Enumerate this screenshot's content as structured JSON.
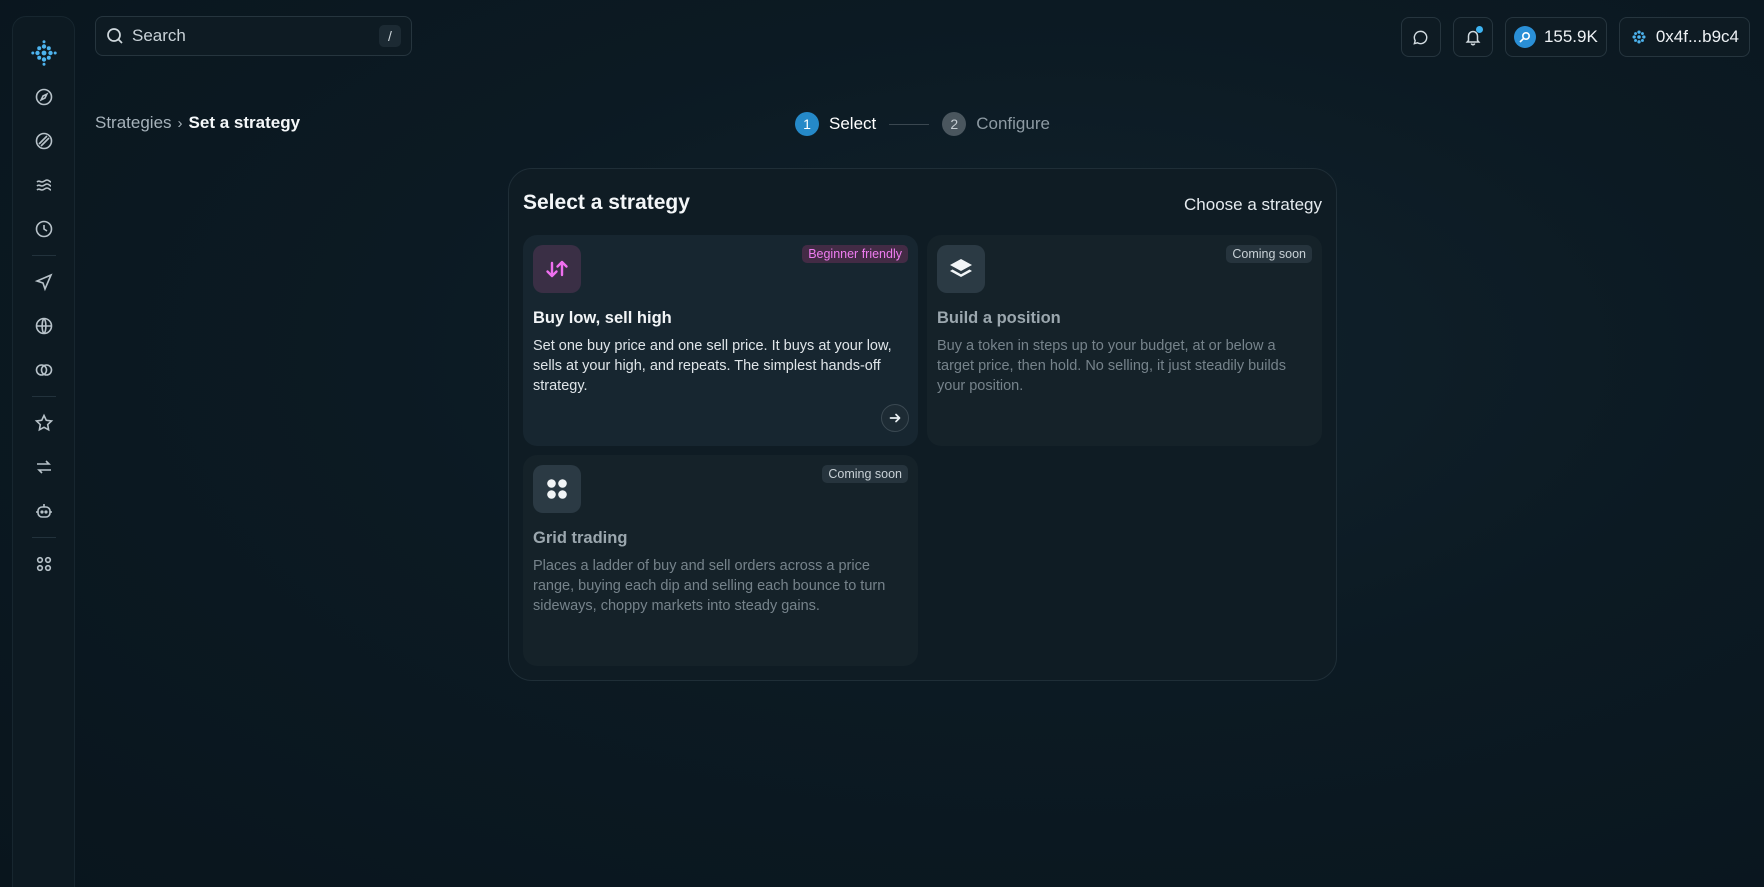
{
  "search": {
    "placeholder": "Search",
    "shortcut": "/"
  },
  "header": {
    "balance": "155.9K",
    "wallet": "0x4f...b9c4"
  },
  "breadcrumb": {
    "parent": "Strategies",
    "separator": "›",
    "current": "Set a strategy"
  },
  "stepper": {
    "steps": [
      {
        "num": "1",
        "label": "Select"
      },
      {
        "num": "2",
        "label": "Configure"
      }
    ]
  },
  "panel": {
    "title": "Select a strategy",
    "subtitle": "Choose a strategy",
    "cards": [
      {
        "title": "Buy low, sell high",
        "badge": "Beginner friendly",
        "desc": "Set one buy price and one sell price. It buys at your low, sells at your high, and repeats. The simplest hands-off strategy.",
        "icon": "arrows-up-down-icon"
      },
      {
        "title": "Build a position",
        "badge": "Coming soon",
        "desc": "Buy a token in steps up to your budget, at or below a target price, then hold. No selling, it just steadily builds your position.",
        "icon": "layers-icon"
      },
      {
        "title": "Grid trading",
        "badge": "Coming soon",
        "desc": "Places a ladder of buy and sell orders across a price range, buying each dip and selling each bounce to turn sideways, choppy markets into steady gains.",
        "icon": "grid-icon"
      }
    ]
  },
  "colors": {
    "accent": "#2589c8",
    "pink": "#ef7cf0",
    "background": "#0b1821"
  }
}
